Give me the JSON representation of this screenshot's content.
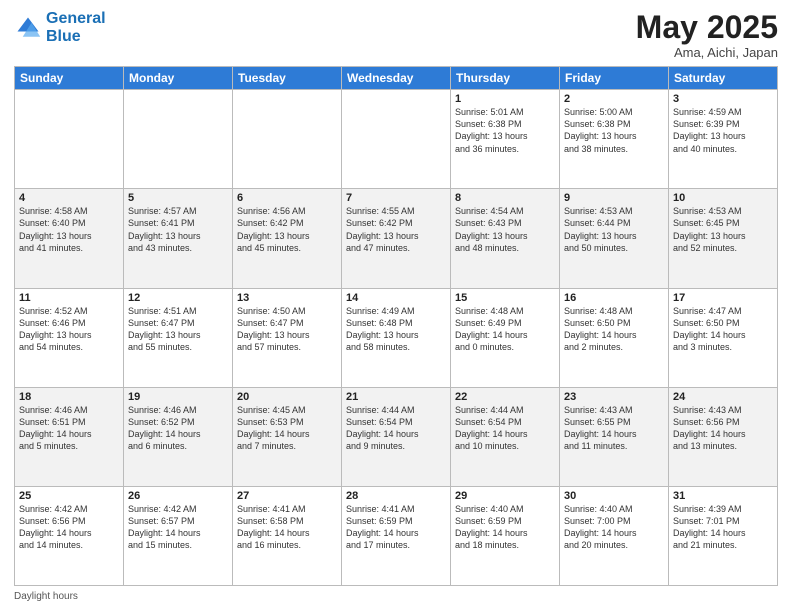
{
  "header": {
    "logo_line1": "General",
    "logo_line2": "Blue",
    "title": "May 2025",
    "subtitle": "Ama, Aichi, Japan"
  },
  "days_of_week": [
    "Sunday",
    "Monday",
    "Tuesday",
    "Wednesday",
    "Thursday",
    "Friday",
    "Saturday"
  ],
  "weeks": [
    [
      {
        "day": "",
        "info": ""
      },
      {
        "day": "",
        "info": ""
      },
      {
        "day": "",
        "info": ""
      },
      {
        "day": "",
        "info": ""
      },
      {
        "day": "1",
        "info": "Sunrise: 5:01 AM\nSunset: 6:38 PM\nDaylight: 13 hours\nand 36 minutes."
      },
      {
        "day": "2",
        "info": "Sunrise: 5:00 AM\nSunset: 6:38 PM\nDaylight: 13 hours\nand 38 minutes."
      },
      {
        "day": "3",
        "info": "Sunrise: 4:59 AM\nSunset: 6:39 PM\nDaylight: 13 hours\nand 40 minutes."
      }
    ],
    [
      {
        "day": "4",
        "info": "Sunrise: 4:58 AM\nSunset: 6:40 PM\nDaylight: 13 hours\nand 41 minutes."
      },
      {
        "day": "5",
        "info": "Sunrise: 4:57 AM\nSunset: 6:41 PM\nDaylight: 13 hours\nand 43 minutes."
      },
      {
        "day": "6",
        "info": "Sunrise: 4:56 AM\nSunset: 6:42 PM\nDaylight: 13 hours\nand 45 minutes."
      },
      {
        "day": "7",
        "info": "Sunrise: 4:55 AM\nSunset: 6:42 PM\nDaylight: 13 hours\nand 47 minutes."
      },
      {
        "day": "8",
        "info": "Sunrise: 4:54 AM\nSunset: 6:43 PM\nDaylight: 13 hours\nand 48 minutes."
      },
      {
        "day": "9",
        "info": "Sunrise: 4:53 AM\nSunset: 6:44 PM\nDaylight: 13 hours\nand 50 minutes."
      },
      {
        "day": "10",
        "info": "Sunrise: 4:53 AM\nSunset: 6:45 PM\nDaylight: 13 hours\nand 52 minutes."
      }
    ],
    [
      {
        "day": "11",
        "info": "Sunrise: 4:52 AM\nSunset: 6:46 PM\nDaylight: 13 hours\nand 54 minutes."
      },
      {
        "day": "12",
        "info": "Sunrise: 4:51 AM\nSunset: 6:47 PM\nDaylight: 13 hours\nand 55 minutes."
      },
      {
        "day": "13",
        "info": "Sunrise: 4:50 AM\nSunset: 6:47 PM\nDaylight: 13 hours\nand 57 minutes."
      },
      {
        "day": "14",
        "info": "Sunrise: 4:49 AM\nSunset: 6:48 PM\nDaylight: 13 hours\nand 58 minutes."
      },
      {
        "day": "15",
        "info": "Sunrise: 4:48 AM\nSunset: 6:49 PM\nDaylight: 14 hours\nand 0 minutes."
      },
      {
        "day": "16",
        "info": "Sunrise: 4:48 AM\nSunset: 6:50 PM\nDaylight: 14 hours\nand 2 minutes."
      },
      {
        "day": "17",
        "info": "Sunrise: 4:47 AM\nSunset: 6:50 PM\nDaylight: 14 hours\nand 3 minutes."
      }
    ],
    [
      {
        "day": "18",
        "info": "Sunrise: 4:46 AM\nSunset: 6:51 PM\nDaylight: 14 hours\nand 5 minutes."
      },
      {
        "day": "19",
        "info": "Sunrise: 4:46 AM\nSunset: 6:52 PM\nDaylight: 14 hours\nand 6 minutes."
      },
      {
        "day": "20",
        "info": "Sunrise: 4:45 AM\nSunset: 6:53 PM\nDaylight: 14 hours\nand 7 minutes."
      },
      {
        "day": "21",
        "info": "Sunrise: 4:44 AM\nSunset: 6:54 PM\nDaylight: 14 hours\nand 9 minutes."
      },
      {
        "day": "22",
        "info": "Sunrise: 4:44 AM\nSunset: 6:54 PM\nDaylight: 14 hours\nand 10 minutes."
      },
      {
        "day": "23",
        "info": "Sunrise: 4:43 AM\nSunset: 6:55 PM\nDaylight: 14 hours\nand 11 minutes."
      },
      {
        "day": "24",
        "info": "Sunrise: 4:43 AM\nSunset: 6:56 PM\nDaylight: 14 hours\nand 13 minutes."
      }
    ],
    [
      {
        "day": "25",
        "info": "Sunrise: 4:42 AM\nSunset: 6:56 PM\nDaylight: 14 hours\nand 14 minutes."
      },
      {
        "day": "26",
        "info": "Sunrise: 4:42 AM\nSunset: 6:57 PM\nDaylight: 14 hours\nand 15 minutes."
      },
      {
        "day": "27",
        "info": "Sunrise: 4:41 AM\nSunset: 6:58 PM\nDaylight: 14 hours\nand 16 minutes."
      },
      {
        "day": "28",
        "info": "Sunrise: 4:41 AM\nSunset: 6:59 PM\nDaylight: 14 hours\nand 17 minutes."
      },
      {
        "day": "29",
        "info": "Sunrise: 4:40 AM\nSunset: 6:59 PM\nDaylight: 14 hours\nand 18 minutes."
      },
      {
        "day": "30",
        "info": "Sunrise: 4:40 AM\nSunset: 7:00 PM\nDaylight: 14 hours\nand 20 minutes."
      },
      {
        "day": "31",
        "info": "Sunrise: 4:39 AM\nSunset: 7:01 PM\nDaylight: 14 hours\nand 21 minutes."
      }
    ]
  ],
  "footer": {
    "daylight_label": "Daylight hours"
  }
}
